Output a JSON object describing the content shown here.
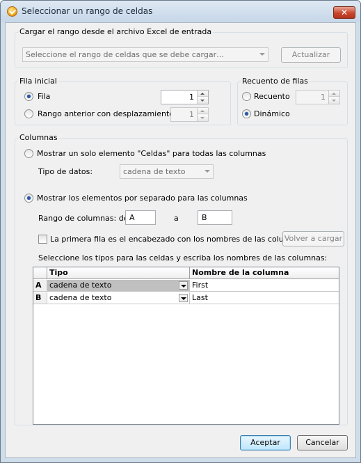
{
  "window": {
    "title": "Seleccionar un rango de celdas",
    "close_label": "✕"
  },
  "load_group": {
    "legend": "Cargar el rango desde el archivo Excel de entrada",
    "range_combo_placeholder": "Seleccione el rango de celdas que se debe cargar…",
    "update_button": "Actualizar"
  },
  "start_row": {
    "legend": "Fila inicial",
    "row_option": "Fila",
    "row_value": "1",
    "prev_range_option": "Rango anterior con desplazamiento de",
    "offset_value": "1",
    "row_selected": true
  },
  "row_count": {
    "legend": "Recuento de filas",
    "count_option": "Recuento",
    "count_value": "1",
    "dynamic_option": "Dinámico",
    "dynamic_selected": true
  },
  "columns": {
    "legend": "Columnas",
    "single_option": "Mostrar un solo elemento \"Celdas\" para todas las columnas",
    "data_type_label": "Tipo de datos:",
    "data_type_value": "cadena de texto",
    "separate_option": "Mostrar los elementos por separado para las columnas",
    "separate_selected": true,
    "range_label": "Rango de columnas: de",
    "range_from": "A",
    "range_to_label": "a",
    "range_to": "B",
    "header_checkbox": "La primera fila es el encabezado con los nombres de las columnas",
    "header_checked": false,
    "reload_button": "Volver a cargar",
    "grid_caption": "Seleccione los tipos para las celdas y escriba los nombres de las columnas:",
    "grid_headers": [
      "",
      "Tipo",
      "Nombre de la columna"
    ],
    "grid_rows": [
      {
        "col": "A",
        "type": "cadena de texto",
        "name": "First"
      },
      {
        "col": "B",
        "type": "cadena de texto",
        "name": "Last"
      }
    ]
  },
  "footer": {
    "ok_button": "Aceptar",
    "cancel_button": "Cancelar"
  }
}
